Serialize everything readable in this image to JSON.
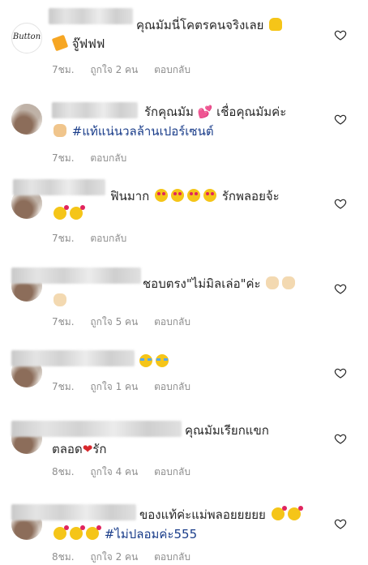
{
  "comments": [
    {
      "line1_text": "คุณมัมนี่โคตรคนจริงเลย",
      "line2_text": "จู๊ฟฟฟ",
      "time": "7ชม.",
      "likes": "ถูกใจ 2 คน",
      "reply": "ตอบกลับ",
      "avatar_text": "Button"
    },
    {
      "line1_text": "รักคุณมัม",
      "line1_text_b": "เชื่อคุณมัมค่ะ",
      "line2_tag": "#แท้แน่นวลล้านเปอร์เซนต์",
      "time": "7ชม.",
      "reply": "ตอบกลับ"
    },
    {
      "line1_text": "ฟินมาก",
      "line1_text_b": "รักพลอยจ้ะ",
      "time": "7ชม.",
      "reply": "ตอบกลับ"
    },
    {
      "line1_text": "ชอบตรง\"ไม่มิลเล่อ\"ค่ะ",
      "time": "7ชม.",
      "likes": "ถูกใจ 5 คน",
      "reply": "ตอบกลับ"
    },
    {
      "time": "7ชม.",
      "likes": "ถูกใจ 1 คน",
      "reply": "ตอบกลับ"
    },
    {
      "line1_text": "คุณมัมเรียกแขก",
      "line2_text": "ตลอด",
      "line2_text_b": "รัก",
      "time": "8ชม.",
      "likes": "ถูกใจ 4 คน",
      "reply": "ตอบกลับ"
    },
    {
      "line1_text": "ของแท้ค่ะแม่พลอยยยยย",
      "line2_tag": "#ไม่ปลอมค่ะ555",
      "time": "8ชม.",
      "likes": "ถูกใจ 2 คน",
      "reply": "ตอบกลับ"
    }
  ],
  "icons": {
    "like": "heart-outline-icon"
  },
  "colors": {
    "text": "#262626",
    "meta": "#8e8e8e",
    "hashtag": "#1a3d8a"
  }
}
